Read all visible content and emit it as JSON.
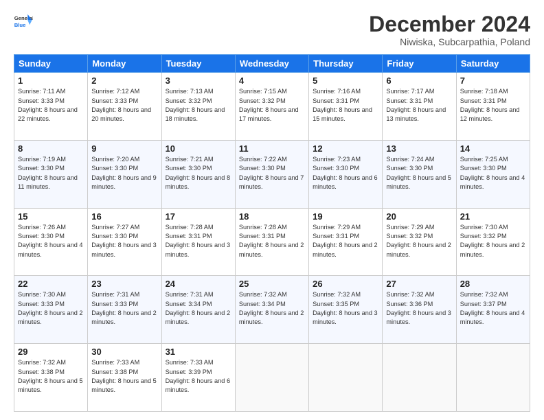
{
  "header": {
    "logo_line1": "General",
    "logo_line2": "Blue",
    "month_title": "December 2024",
    "subtitle": "Niwiska, Subcarpathia, Poland"
  },
  "days_of_week": [
    "Sunday",
    "Monday",
    "Tuesday",
    "Wednesday",
    "Thursday",
    "Friday",
    "Saturday"
  ],
  "weeks": [
    [
      {
        "day": "1",
        "sunrise": "7:11 AM",
        "sunset": "3:33 PM",
        "daylight": "8 hours and 22 minutes."
      },
      {
        "day": "2",
        "sunrise": "7:12 AM",
        "sunset": "3:33 PM",
        "daylight": "8 hours and 20 minutes."
      },
      {
        "day": "3",
        "sunrise": "7:13 AM",
        "sunset": "3:32 PM",
        "daylight": "8 hours and 18 minutes."
      },
      {
        "day": "4",
        "sunrise": "7:15 AM",
        "sunset": "3:32 PM",
        "daylight": "8 hours and 17 minutes."
      },
      {
        "day": "5",
        "sunrise": "7:16 AM",
        "sunset": "3:31 PM",
        "daylight": "8 hours and 15 minutes."
      },
      {
        "day": "6",
        "sunrise": "7:17 AM",
        "sunset": "3:31 PM",
        "daylight": "8 hours and 13 minutes."
      },
      {
        "day": "7",
        "sunrise": "7:18 AM",
        "sunset": "3:31 PM",
        "daylight": "8 hours and 12 minutes."
      }
    ],
    [
      {
        "day": "8",
        "sunrise": "7:19 AM",
        "sunset": "3:30 PM",
        "daylight": "8 hours and 11 minutes."
      },
      {
        "day": "9",
        "sunrise": "7:20 AM",
        "sunset": "3:30 PM",
        "daylight": "8 hours and 9 minutes."
      },
      {
        "day": "10",
        "sunrise": "7:21 AM",
        "sunset": "3:30 PM",
        "daylight": "8 hours and 8 minutes."
      },
      {
        "day": "11",
        "sunrise": "7:22 AM",
        "sunset": "3:30 PM",
        "daylight": "8 hours and 7 minutes."
      },
      {
        "day": "12",
        "sunrise": "7:23 AM",
        "sunset": "3:30 PM",
        "daylight": "8 hours and 6 minutes."
      },
      {
        "day": "13",
        "sunrise": "7:24 AM",
        "sunset": "3:30 PM",
        "daylight": "8 hours and 5 minutes."
      },
      {
        "day": "14",
        "sunrise": "7:25 AM",
        "sunset": "3:30 PM",
        "daylight": "8 hours and 4 minutes."
      }
    ],
    [
      {
        "day": "15",
        "sunrise": "7:26 AM",
        "sunset": "3:30 PM",
        "daylight": "8 hours and 4 minutes."
      },
      {
        "day": "16",
        "sunrise": "7:27 AM",
        "sunset": "3:30 PM",
        "daylight": "8 hours and 3 minutes."
      },
      {
        "day": "17",
        "sunrise": "7:28 AM",
        "sunset": "3:31 PM",
        "daylight": "8 hours and 3 minutes."
      },
      {
        "day": "18",
        "sunrise": "7:28 AM",
        "sunset": "3:31 PM",
        "daylight": "8 hours and 2 minutes."
      },
      {
        "day": "19",
        "sunrise": "7:29 AM",
        "sunset": "3:31 PM",
        "daylight": "8 hours and 2 minutes."
      },
      {
        "day": "20",
        "sunrise": "7:29 AM",
        "sunset": "3:32 PM",
        "daylight": "8 hours and 2 minutes."
      },
      {
        "day": "21",
        "sunrise": "7:30 AM",
        "sunset": "3:32 PM",
        "daylight": "8 hours and 2 minutes."
      }
    ],
    [
      {
        "day": "22",
        "sunrise": "7:30 AM",
        "sunset": "3:33 PM",
        "daylight": "8 hours and 2 minutes."
      },
      {
        "day": "23",
        "sunrise": "7:31 AM",
        "sunset": "3:33 PM",
        "daylight": "8 hours and 2 minutes."
      },
      {
        "day": "24",
        "sunrise": "7:31 AM",
        "sunset": "3:34 PM",
        "daylight": "8 hours and 2 minutes."
      },
      {
        "day": "25",
        "sunrise": "7:32 AM",
        "sunset": "3:34 PM",
        "daylight": "8 hours and 2 minutes."
      },
      {
        "day": "26",
        "sunrise": "7:32 AM",
        "sunset": "3:35 PM",
        "daylight": "8 hours and 3 minutes."
      },
      {
        "day": "27",
        "sunrise": "7:32 AM",
        "sunset": "3:36 PM",
        "daylight": "8 hours and 3 minutes."
      },
      {
        "day": "28",
        "sunrise": "7:32 AM",
        "sunset": "3:37 PM",
        "daylight": "8 hours and 4 minutes."
      }
    ],
    [
      {
        "day": "29",
        "sunrise": "7:32 AM",
        "sunset": "3:38 PM",
        "daylight": "8 hours and 5 minutes."
      },
      {
        "day": "30",
        "sunrise": "7:33 AM",
        "sunset": "3:38 PM",
        "daylight": "8 hours and 5 minutes."
      },
      {
        "day": "31",
        "sunrise": "7:33 AM",
        "sunset": "3:39 PM",
        "daylight": "8 hours and 6 minutes."
      },
      null,
      null,
      null,
      null
    ]
  ],
  "labels": {
    "sunrise_prefix": "Sunrise: ",
    "sunset_prefix": "Sunset: ",
    "daylight_prefix": "Daylight: "
  }
}
